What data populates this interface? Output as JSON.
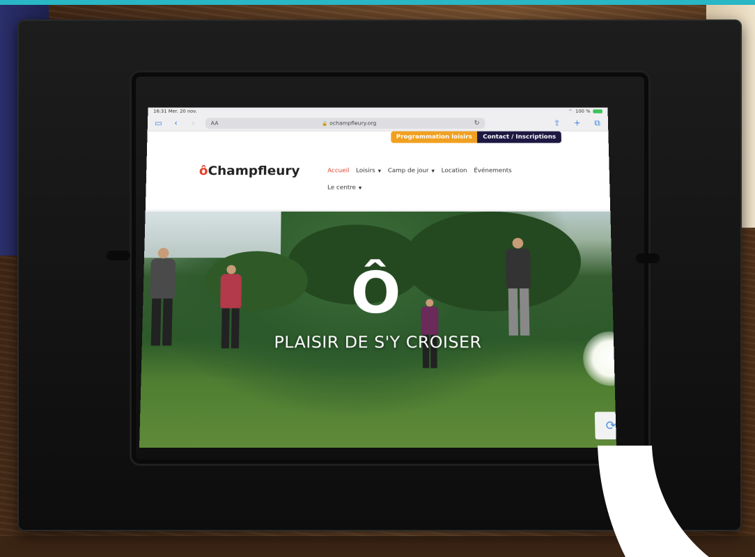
{
  "status": {
    "time": "16:31",
    "date": "Mer. 20 nov.",
    "battery": "100 %"
  },
  "browser": {
    "text_size_label": "AA",
    "url": "ochampfleury.org",
    "icons": [
      "sidebar-icon",
      "back-icon",
      "forward-icon",
      "reload-icon",
      "share-icon",
      "new-tab-icon",
      "tabs-icon"
    ]
  },
  "site": {
    "top_buttons": {
      "programmation": "Programmation loisirs",
      "contact": "Contact / Inscriptions"
    },
    "logo": {
      "mark": "ô",
      "name": "Champfleury"
    },
    "nav": [
      "Accueil",
      "Loisirs",
      "Camp de jour",
      "Location",
      "Événements",
      "Le centre"
    ],
    "active_nav": "Accueil",
    "hero": {
      "mark": "Ô",
      "tagline": "PLAISIR DE S'Y CROISER"
    }
  },
  "colors": {
    "accent_orange": "#f0a020",
    "navy": "#1d1842",
    "brand_red": "#e0402a",
    "frame_teal": "#29b6c5"
  }
}
